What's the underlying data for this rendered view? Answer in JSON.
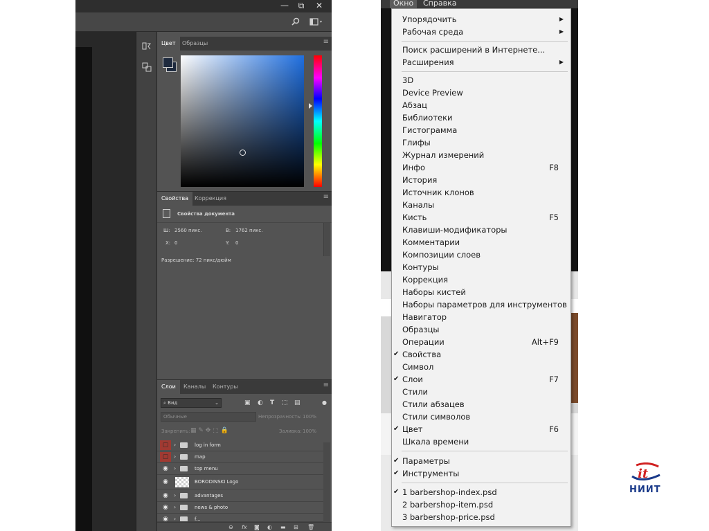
{
  "photoshop": {
    "window_controls": {
      "minimize": "—",
      "maximize": "⧉",
      "close": "✕"
    },
    "color_panel": {
      "tabs": [
        "Цвет",
        "Образцы"
      ],
      "fg_color": "#1e2a3e"
    },
    "properties_panel": {
      "tabs": [
        "Свойства",
        "Коррекция"
      ],
      "section_title": "Свойства документа",
      "width_label": "Ш:",
      "width_value": "2560 пикс.",
      "height_label": "В:",
      "height_value": "1762 пикс.",
      "x_label": "X:",
      "x_value": "0",
      "y_label": "Y:",
      "y_value": "0",
      "resolution": "Разрешение: 72 пикс/дюйм"
    },
    "layers_panel": {
      "tabs": [
        "Слои",
        "Каналы",
        "Контуры"
      ],
      "kind_filter": "Вид",
      "blend_mode": "Обычные",
      "opacity_label": "Непрозрачность:",
      "opacity_value": "100%",
      "lock_label": "Закрепить:",
      "fill_label": "Заливка:",
      "fill_value": "100%",
      "layers": [
        {
          "name": "log in form",
          "type": "folder",
          "visibility": "hidden-red"
        },
        {
          "name": "map",
          "type": "folder",
          "visibility": "hidden-red"
        },
        {
          "name": "top menu",
          "type": "folder",
          "visibility": "visible"
        },
        {
          "name": "BORODINSKI Logo",
          "type": "image",
          "visibility": "visible"
        },
        {
          "name": "advantages",
          "type": "folder",
          "visibility": "visible"
        },
        {
          "name": "news & photo",
          "type": "folder",
          "visibility": "visible"
        },
        {
          "name": "f...",
          "type": "folder",
          "visibility": "visible"
        }
      ]
    }
  },
  "menubar": {
    "items": [
      "Окно",
      "Справка"
    ],
    "active": "Окно"
  },
  "window_menu": {
    "group1": [
      {
        "label": "Упорядочить",
        "submenu": true
      },
      {
        "label": "Рабочая среда",
        "submenu": true
      }
    ],
    "group2": [
      {
        "label": "Поиск расширений в Интернете..."
      },
      {
        "label": "Расширения",
        "submenu": true
      }
    ],
    "group3": [
      {
        "label": "3D"
      },
      {
        "label": "Device Preview"
      },
      {
        "label": "Абзац"
      },
      {
        "label": "Библиотеки"
      },
      {
        "label": "Гистограмма"
      },
      {
        "label": "Глифы"
      },
      {
        "label": "Журнал измерений"
      },
      {
        "label": "Инфо",
        "shortcut": "F8"
      },
      {
        "label": "История"
      },
      {
        "label": "Источник клонов"
      },
      {
        "label": "Каналы"
      },
      {
        "label": "Кисть",
        "shortcut": "F5"
      },
      {
        "label": "Клавиши-модификаторы"
      },
      {
        "label": "Комментарии"
      },
      {
        "label": "Композиции слоев"
      },
      {
        "label": "Контуры"
      },
      {
        "label": "Коррекция"
      },
      {
        "label": "Наборы кистей"
      },
      {
        "label": "Наборы параметров для инструментов"
      },
      {
        "label": "Навигатор"
      },
      {
        "label": "Образцы"
      },
      {
        "label": "Операции",
        "shortcut": "Alt+F9"
      },
      {
        "label": "Свойства",
        "checked": true
      },
      {
        "label": "Символ"
      },
      {
        "label": "Слои",
        "shortcut": "F7",
        "checked": true
      },
      {
        "label": "Стили"
      },
      {
        "label": "Стили абзацев"
      },
      {
        "label": "Стили символов"
      },
      {
        "label": "Цвет",
        "shortcut": "F6",
        "checked": true
      },
      {
        "label": "Шкала времени"
      }
    ],
    "group4": [
      {
        "label": "Параметры",
        "checked": true
      },
      {
        "label": "Инструменты",
        "checked": true
      }
    ],
    "group5": [
      {
        "label": "1 barbershop-index.psd",
        "checked": true
      },
      {
        "label": "2 barbershop-item.psd"
      },
      {
        "label": "3 barbershop-price.psd"
      }
    ]
  },
  "logo": {
    "text": "НИИТ"
  },
  "colors": {
    "accent_red": "#a03a32",
    "menu_bg": "#f2f2f2",
    "ps_panel": "#535353",
    "logo_red": "#d02020",
    "logo_blue": "#1a3a8a"
  }
}
